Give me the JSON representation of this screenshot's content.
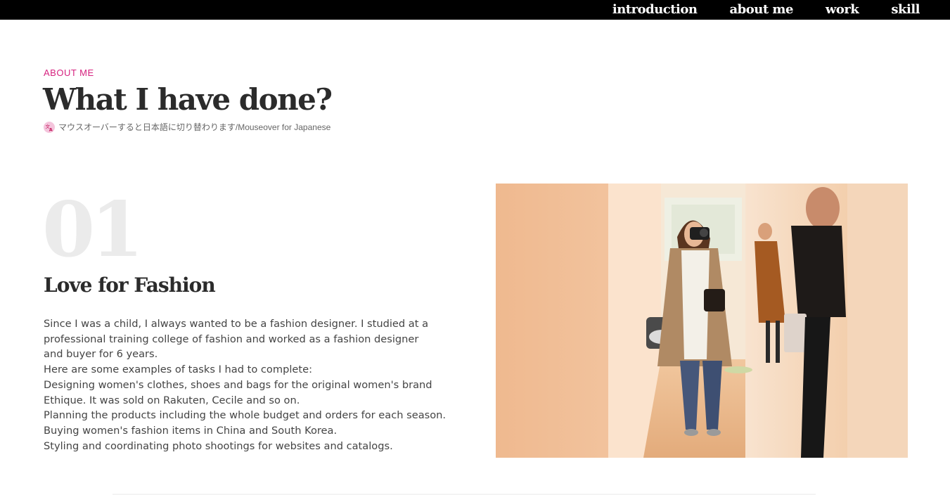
{
  "nav": {
    "items": [
      {
        "label": "introduction"
      },
      {
        "label": "about me"
      },
      {
        "label": "work"
      },
      {
        "label": "skill"
      }
    ]
  },
  "header": {
    "section_label": "ABOUT ME",
    "title": "What I have done?",
    "translate_hint": "マウスオーバーすると日本語に切り替わります/Mouseover for Japanese"
  },
  "card": {
    "number": "01",
    "title": "Love for Fashion",
    "paragraphs": [
      "Since I was a child, I always wanted to be a fashion designer. I studied at a professional training college of fashion and worked as a fashion designer and buyer for 6 years.",
      "Here are some examples of tasks I had to complete:",
      "Designing women's clothes, shoes and bags for the original women's brand Ethique. It was sold on Rakuten, Cecile and so on.",
      "Planning the products including the whole budget and orders for each season.",
      "Buying women's fashion items in China and South Korea.",
      "Styling and coordinating photo shootings for websites and catalogs."
    ]
  },
  "colors": {
    "accent": "#d6227f",
    "topbar": "#000000",
    "number_watermark": "#ebebeb"
  }
}
